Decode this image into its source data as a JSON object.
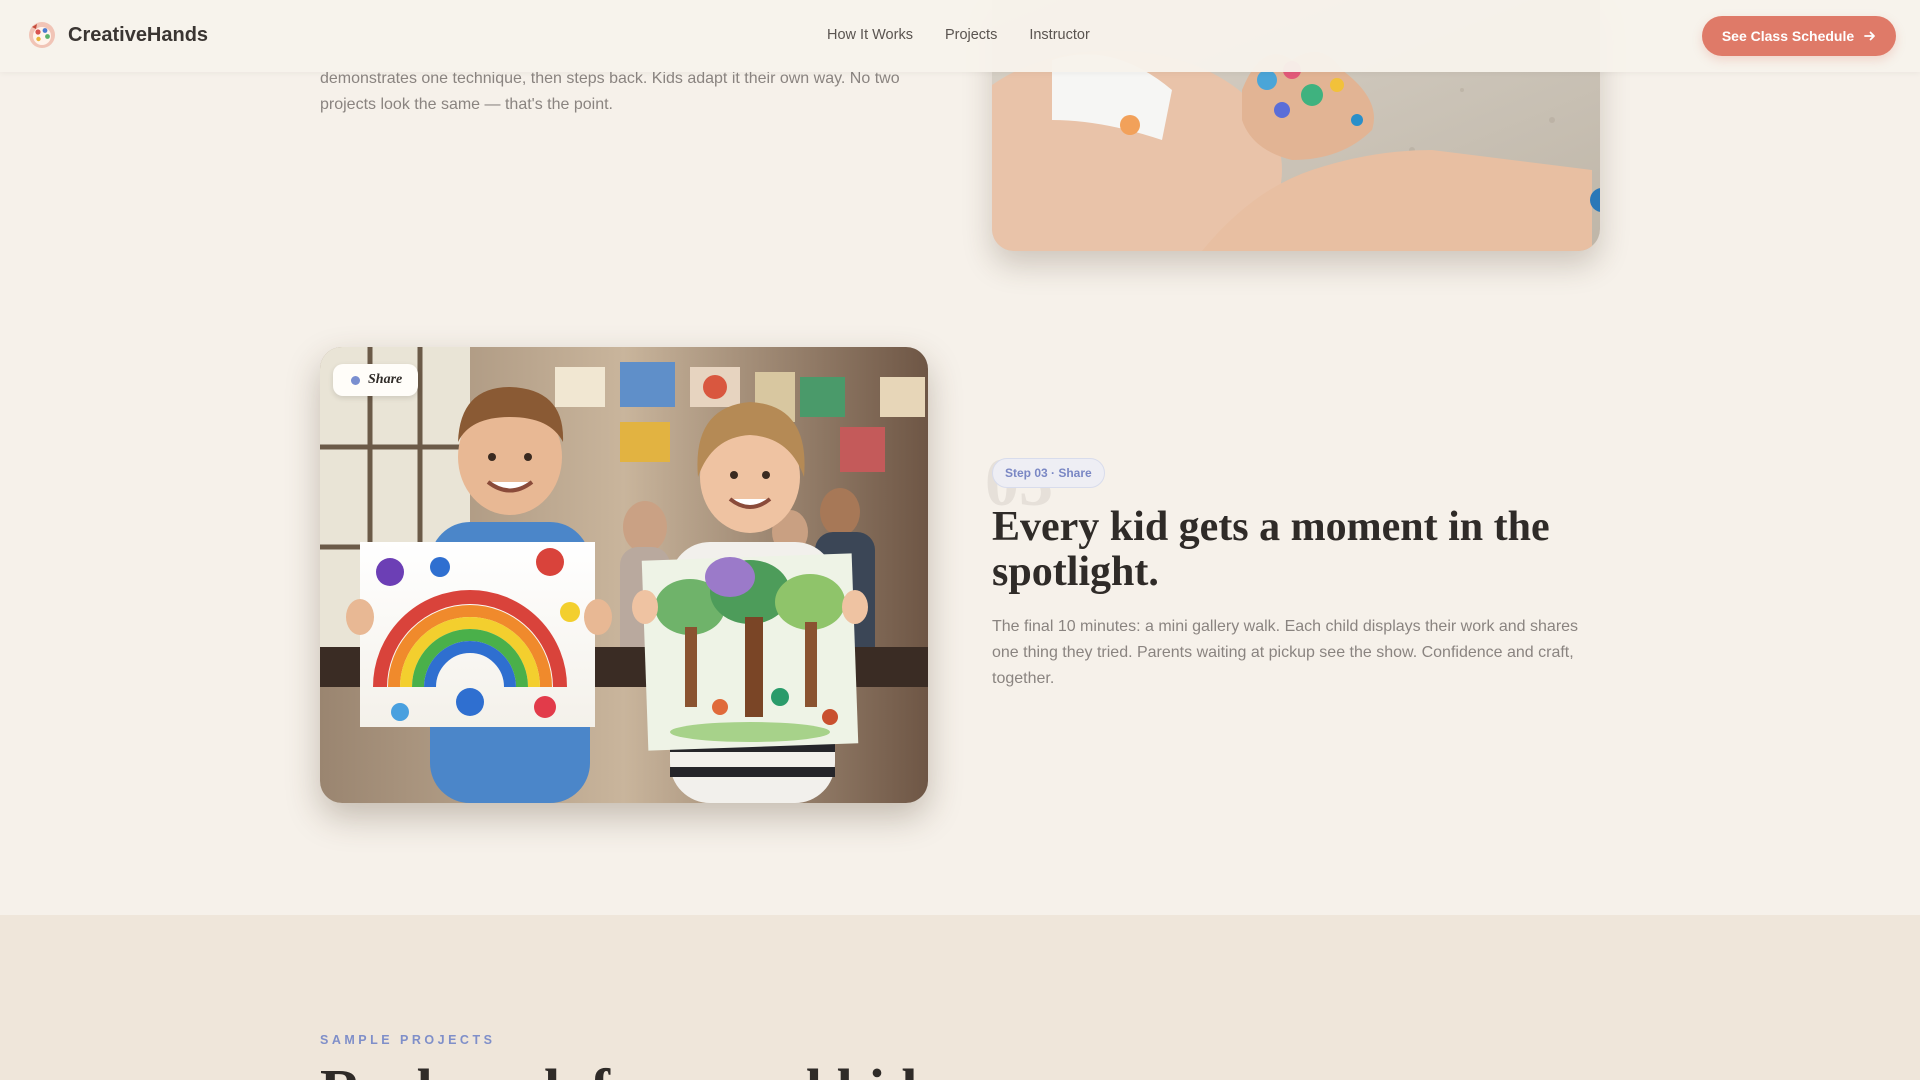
{
  "header": {
    "brand": "CreativeHands",
    "nav": [
      "How It Works",
      "Projects",
      "Instructor"
    ],
    "cta_label": "See Class Schedule"
  },
  "step2": {
    "description": "demonstrates one technique, then steps back. Kids adapt it their own way. No two projects look the same — that's the point."
  },
  "step3": {
    "image_tag": "Share",
    "big_number": "03",
    "badge": "Step 03 · Share",
    "title": "Every kid gets a moment in the spotlight.",
    "description": "The final 10 minutes: a mini gallery walk. Each child displays their work and shares one thing they tried. Parents waiting at pickup see the show. Confidence and craft, together."
  },
  "projects": {
    "eyebrow": "SAMPLE PROJECTS",
    "title": "Real work from real kids"
  },
  "colors": {
    "background": "#f6f1ea",
    "accent": "#df7a68",
    "step_accent": "#7a87c4",
    "band": "#efe6da"
  }
}
